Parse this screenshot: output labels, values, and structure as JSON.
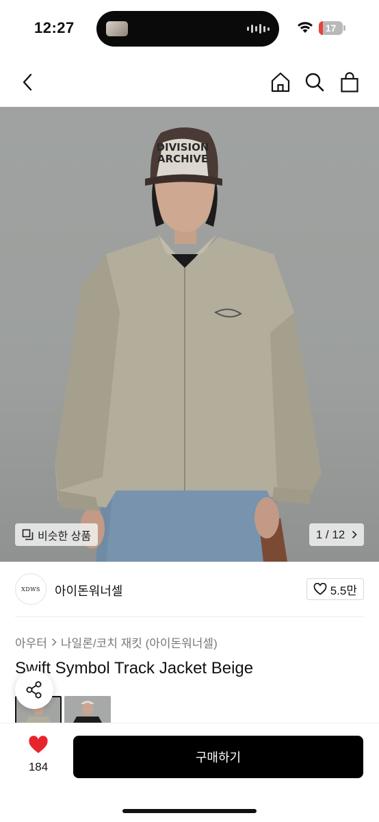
{
  "status_bar": {
    "time": "12:27",
    "battery": "17",
    "battery_level": 0.17,
    "battery_fill_color": "#e8423a"
  },
  "nav": {
    "back_icon": "chevron-left-icon",
    "home_icon": "home-icon",
    "search_icon": "search-icon",
    "bag_icon": "shopping-bag-icon"
  },
  "hero": {
    "similar_label": "비슷한 상품",
    "page_counter": "1 / 12",
    "cap_text": "DIVISION ARCHIVE"
  },
  "shop": {
    "logo_text": "XDWS",
    "name": "아이돈워너셀",
    "likes": "5.5만"
  },
  "breadcrumb": {
    "category": "아우터",
    "subcategory": "나일론/코치 재킷 (아이돈워너셀)"
  },
  "product": {
    "title": "Swift Symbol Track Jacket Beige"
  },
  "bottom": {
    "wish_count": "184",
    "buy_label": "구매하기",
    "heart_color": "#e8232b"
  }
}
